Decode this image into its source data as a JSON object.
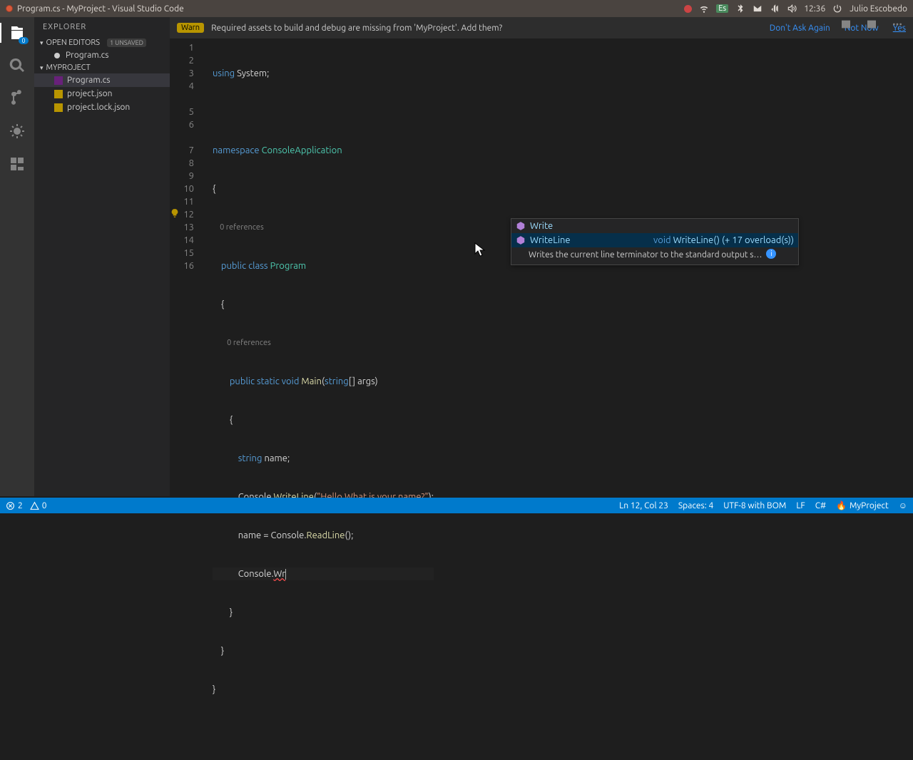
{
  "os_bar": {
    "title": "Program.cs - MyProject - Visual Studio Code",
    "es": "Es",
    "time": "12:36",
    "user": "Julio Escobedo"
  },
  "activity": {
    "badge": "0"
  },
  "sidebar": {
    "title": "EXPLORER",
    "open_editors": "OPEN EDITORS",
    "unsaved": "1 UNSAVED",
    "open_file": "Program.cs",
    "project": "MYPROJECT",
    "files": {
      "program": "Program.cs",
      "project_json": "project.json",
      "project_lock": "project.lock.json"
    }
  },
  "notification": {
    "warn": "Warn",
    "msg": "Required assets to build and debug are missing from 'MyProject'. Add them?",
    "dont_ask": "Don't Ask Again",
    "not_now": "Not Now",
    "yes": "Yes"
  },
  "code": {
    "refs0": "0 references",
    "l1": "using System;",
    "l3a": "namespace ",
    "l3b": "ConsoleApplication",
    "l4": "{",
    "l5a": "    public class ",
    "l5b": "Program",
    "l6": "    {",
    "l7a": "        public static void ",
    "l7b": "Main",
    "l7c": "(",
    "l7d": "string",
    "l7e": "[] args)",
    "l8": "        {",
    "l9a": "            string",
    "l9b": " name;",
    "l10a": "            Console.",
    "l10b": "WriteLine",
    "l10c": "(",
    "l10d": "\"Hello What is your name?\"",
    "l10e": ");",
    "l11a": "            name = Console.",
    "l11b": "ReadLine",
    "l11c": "();",
    "l12a": "            Console.",
    "l12b": "Wr",
    "l13": "        }",
    "l14": "    }",
    "l15": "}"
  },
  "lines": {
    "1": "1",
    "2": "2",
    "3": "3",
    "4": "4",
    "5": "5",
    "6": "6",
    "7": "7",
    "8": "8",
    "9": "9",
    "10": "10",
    "11": "11",
    "12": "12",
    "13": "13",
    "14": "14",
    "15": "15",
    "16": "16"
  },
  "suggest": {
    "write": "Write",
    "writeline": "WriteLine",
    "sig_kw": "void",
    "sig_rest": " WriteLine() (+ 17 overload(s))",
    "doc": "Writes the current line terminator to the standard output s…"
  },
  "status": {
    "errors": "2",
    "warnings": "0",
    "pos": "Ln 12, Col 23",
    "spaces": "Spaces: 4",
    "enc": "UTF-8 with BOM",
    "eol": "LF",
    "lang": "C#",
    "proj": "MyProject",
    "smiley": "☺"
  }
}
